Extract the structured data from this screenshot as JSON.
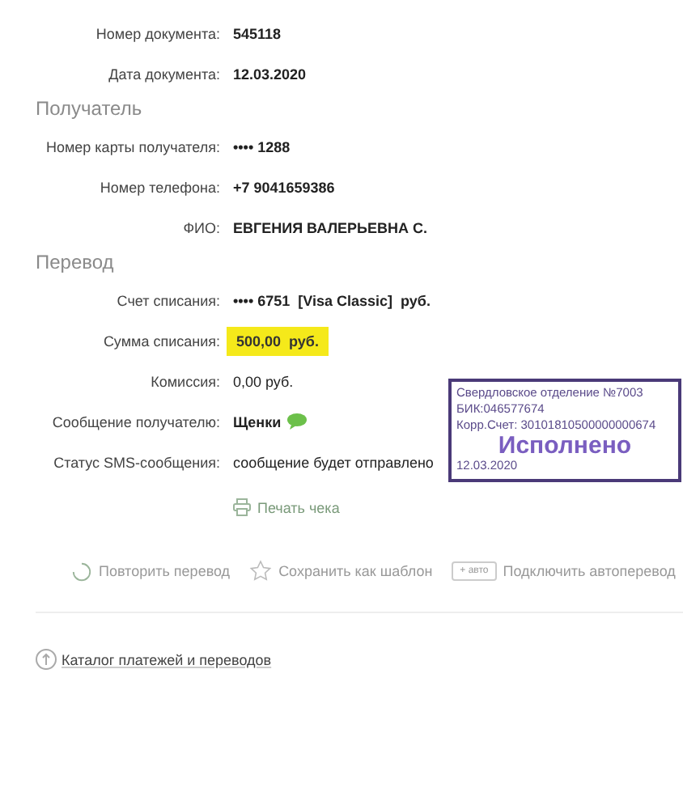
{
  "document": [
    {
      "label": "Номер документа:",
      "value": "545118"
    },
    {
      "label": "Дата документа:",
      "value": "12.03.2020"
    }
  ],
  "recipient": {
    "heading": "Получатель",
    "rows": [
      {
        "label": "Номер карты получателя:",
        "value": "•••• 1288"
      },
      {
        "label": "Номер телефона:",
        "value": "+7 9041659386"
      },
      {
        "label": "ФИО:",
        "value": "ЕВГЕНИЯ ВАЛЕРЬЕВНА С."
      }
    ]
  },
  "transfer": {
    "heading": "Перевод",
    "rows": [
      {
        "label": "Счет списания:",
        "value": "•••• 6751  [Visa Classic]  руб.",
        "kind": "bold"
      },
      {
        "label": "Сумма списания:",
        "value": "500,00  руб.",
        "kind": "highlight"
      },
      {
        "label": "Комиссия:",
        "value": "0,00 руб.",
        "kind": "plain"
      },
      {
        "label": "Сообщение получателю:",
        "value": "Щенки",
        "kind": "message"
      },
      {
        "label": "Статус SMS-сообщения:",
        "value": "сообщение будет отправлено",
        "kind": "plain"
      }
    ]
  },
  "stamp": {
    "lines": [
      "Свердловское отделение №7003",
      "БИК:046577674",
      "Корр.Счет: 30101810500000000674"
    ],
    "status": "Исполнено",
    "date": "12.03.2020"
  },
  "print_link": "Печать чека",
  "actions": [
    {
      "kind": "repeat",
      "label": "Повторить перевод"
    },
    {
      "kind": "template",
      "label": "Сохранить как шаблон"
    },
    {
      "kind": "auto",
      "badge": "+ авто",
      "label": "Подключить автоперевод"
    }
  ],
  "catalog_link": "Каталог платежей и переводов"
}
